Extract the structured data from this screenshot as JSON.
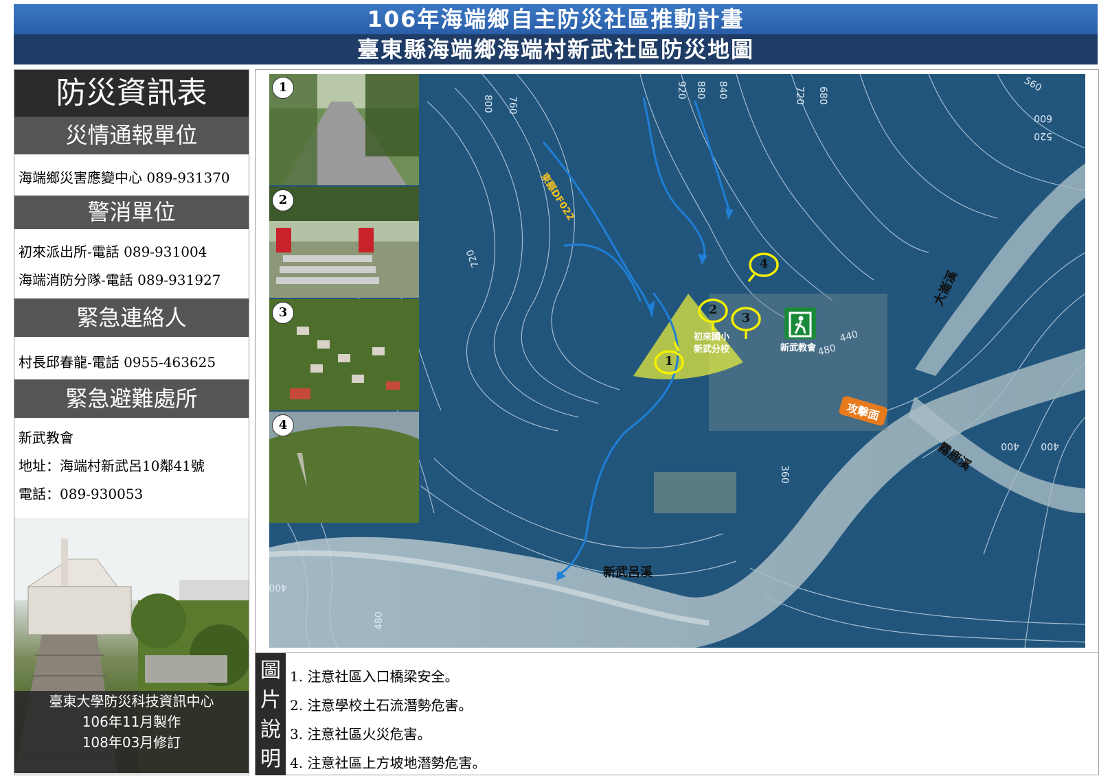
{
  "header": {
    "title_line1": "106年海端鄉自主防災社區推動計畫",
    "title_line2": "臺東縣海端鄉海端村新武社區防災地圖"
  },
  "info_panel": {
    "title": "防災資訊表",
    "sections": [
      {
        "heading": "災情通報單位",
        "lines": [
          "海端鄉災害應變中心 089-931370"
        ]
      },
      {
        "heading": "警消單位",
        "lines": [
          "初來派出所-電話  089-931004",
          "海端消防分隊-電話  089-931927"
        ]
      },
      {
        "heading": "緊急連絡人",
        "lines": [
          "村長邱春龍-電話  0955-463625"
        ]
      },
      {
        "heading": "緊急避難處所",
        "lines": [
          "新武教會",
          "地址：海端村新武呂10鄰41號",
          "電話：089-930053"
        ]
      }
    ],
    "credit": [
      "臺東大學防災科技資訊中心",
      "106年11月製作",
      "108年03月修訂"
    ]
  },
  "map": {
    "photo_numbers": [
      "1",
      "2",
      "3",
      "4"
    ],
    "contours": [
      "800",
      "760",
      "920",
      "880",
      "840",
      "720",
      "680",
      "560",
      "600",
      "520",
      "720",
      "440",
      "480",
      "400",
      "400",
      "360",
      "400",
      "480"
    ],
    "debris_flow_label": "東縣DF022",
    "marker_numbers": [
      "1",
      "2",
      "3",
      "4"
    ],
    "school_label_line1": "初來國小",
    "school_label_line2": "新武分校",
    "shelter_label": "新武教會",
    "river_main": "新武呂溪",
    "river_da": "大崙溪",
    "river_wu": "霧鹿溪",
    "attack_label": "攻擊面"
  },
  "caption": {
    "label_chars": [
      "圖",
      "片",
      "說",
      "明"
    ],
    "notes": [
      "1. 注意社區入口橋梁安全。",
      "2. 注意學校土石流潛勢危害。",
      "3. 注意社區火災危害。",
      "4. 注意社區上方坡地潛勢危害。"
    ]
  },
  "colors": {
    "header_blue": "#2f6bb5",
    "header_navy": "#1f3c66",
    "panel_dark": "#2b2b2b",
    "panel_gray": "#555555",
    "hazard_yellow": "#f2f200",
    "flow_blue": "#1e7fd6",
    "attack_orange": "#e87a1e",
    "shelter_green": "#1a8a3a"
  }
}
